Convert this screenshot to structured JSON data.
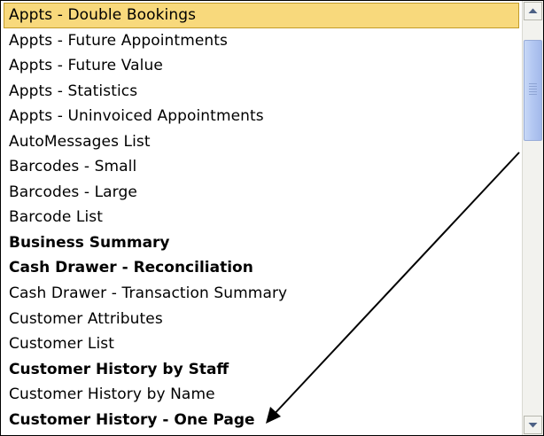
{
  "report_list": {
    "items": [
      {
        "label": "Appts - Double Bookings",
        "bold": false,
        "selected": true
      },
      {
        "label": "Appts - Future Appointments",
        "bold": false,
        "selected": false
      },
      {
        "label": "Appts - Future Value",
        "bold": false,
        "selected": false
      },
      {
        "label": "Appts - Statistics",
        "bold": false,
        "selected": false
      },
      {
        "label": "Appts - Uninvoiced Appointments",
        "bold": false,
        "selected": false
      },
      {
        "label": "AutoMessages List",
        "bold": false,
        "selected": false
      },
      {
        "label": "Barcodes - Small",
        "bold": false,
        "selected": false
      },
      {
        "label": "Barcodes - Large",
        "bold": false,
        "selected": false
      },
      {
        "label": "Barcode List",
        "bold": false,
        "selected": false
      },
      {
        "label": "Business Summary",
        "bold": true,
        "selected": false
      },
      {
        "label": "Cash Drawer - Reconciliation",
        "bold": true,
        "selected": false
      },
      {
        "label": "Cash Drawer - Transaction Summary",
        "bold": false,
        "selected": false
      },
      {
        "label": "Customer Attributes",
        "bold": false,
        "selected": false
      },
      {
        "label": "Customer List",
        "bold": false,
        "selected": false
      },
      {
        "label": "Customer History by Staff",
        "bold": true,
        "selected": false
      },
      {
        "label": "Customer History by Name",
        "bold": false,
        "selected": false
      },
      {
        "label": "Customer History - One Page",
        "bold": true,
        "selected": false
      }
    ]
  },
  "scrollbar": {
    "up_icon": "scroll-up-arrow-icon",
    "down_icon": "scroll-down-arrow-icon",
    "thumb_position_fraction": 0.0
  },
  "colors": {
    "selection_fill": "#f8d97c",
    "selection_border": "#c39c2a",
    "scroll_thumb": "#b4c8f2",
    "annotation_arrow": "#000000"
  },
  "annotation": {
    "icon": "pointer-arrow-icon"
  }
}
